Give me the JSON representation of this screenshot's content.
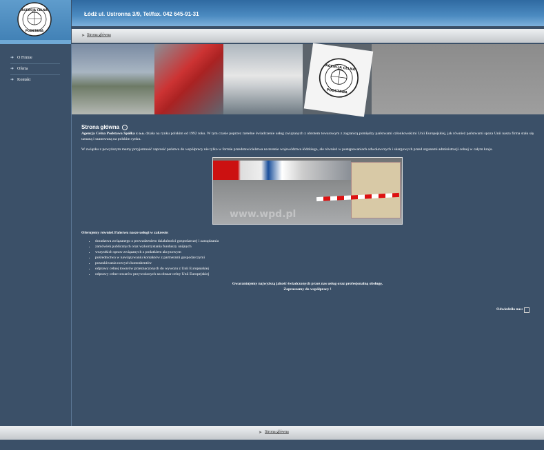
{
  "logo": {
    "line1": "AGENCJA CELNA",
    "line2": "PODSTAWA"
  },
  "header": {
    "address": "Łódź ul. Ustronna 3/9, Tel/fax. 042 645-91-31"
  },
  "breadcrumb": {
    "label": "Strona główna"
  },
  "sidebar": {
    "items": [
      {
        "label": "O Firmie"
      },
      {
        "label": "Oferta"
      },
      {
        "label": "Kontakt"
      }
    ]
  },
  "content": {
    "title": "Strona główna",
    "para1_bold": "Agencja Celna Podstawa Spółka z o.o.",
    "para1_rest": " działa na rynku polskim od 1992 roku. W tym czasie poprzez rzetelne świadczenie usług związanych z obrotem towarowym z zagranicą pomiędzy państwami członkowskimi Unii Europejskiej, jak również państwami spoza Unii nasza firma stała się uznaną i szanowaną na polskim rynku.",
    "para2": "W związku z powyższym mamy przyjemność zaprosić państwa do współpracy nie tylko w formie przedstawicielstwa na terenie województwa łódzkiego, ale również w postępowaniach odwoławczych i skargowych przed organami administracji celnej w całym kraju.",
    "photo_watermark": "www.wpd.pl",
    "services_title": "Oferujemy również Państwu nasze usługi w zakresie:",
    "services": [
      "doradztwa związanego z prowadzeniem działalności gospodarczej i zarządzania",
      "zamówień publicznych oraz wykorzystania funduszy unijnych",
      "wszystkich spraw związanych z podatkiem akcyzowym",
      "pośrednictwa w nawiązywaniu kontaktów z partnerami gospodarczymi",
      "poszukiwania nowych kontrahentów",
      "odprawy celnej towarów przeznaczonych do wywozu z Unii Europejskiej",
      "odprawy celne towarów przywożonych na obszar celny Unii Europejskiej"
    ],
    "closing1": "Gwarantujemy najwyższą jakość świadczonych przez nas usług oraz profesjonalną obsługę.",
    "closing2": "Zapraszamy do współpracy !",
    "visits_label": "Odwiedziło nas:"
  },
  "footer": {
    "label": "Strona główna"
  },
  "colors": {
    "background": "#3b5068",
    "header_blue": "#4b8ac0"
  }
}
